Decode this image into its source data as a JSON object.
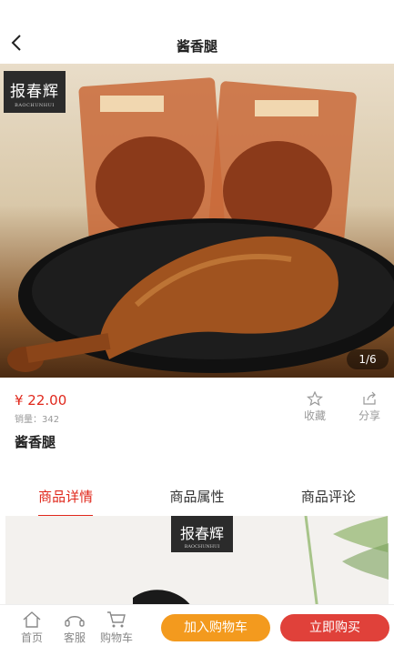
{
  "header": {
    "title": "酱香腿"
  },
  "hero": {
    "brand": "报春辉",
    "brand_sub": "BAOCHUNHUI",
    "counter": "1/6"
  },
  "product": {
    "price": "¥ 22.00",
    "sales": "销量：342",
    "name": "酱香腿",
    "favorite_label": "收藏",
    "share_label": "分享"
  },
  "tabs": [
    {
      "label": "商品详情"
    },
    {
      "label": "商品属性"
    },
    {
      "label": "商品评论"
    }
  ],
  "detail": {
    "brand": "报春辉",
    "brand_sub": "BAOCHUNHUI"
  },
  "bottom": {
    "home": "首页",
    "service": "客服",
    "cart": "购物车",
    "add_to_cart": "加入购物车",
    "buy_now": "立即购买"
  },
  "colors": {
    "accent": "#e0281c",
    "cart_button": "#f39a1e",
    "buy_button": "#e0413a"
  }
}
